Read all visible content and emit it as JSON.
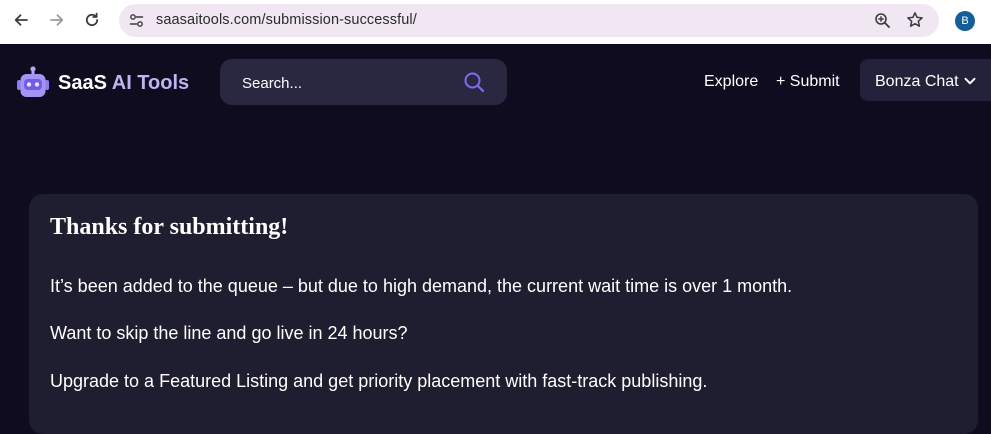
{
  "browser": {
    "url": "saasaitools.com/submission-successful/",
    "profile_initial": "B"
  },
  "header": {
    "logo_text_main": "SaaS",
    "logo_text_accent": " AI Tools",
    "search_placeholder": "Search...",
    "nav": {
      "explore_label": "Explore",
      "submit_label": "+ Submit"
    },
    "chat_dropdown_label": "Bonza Chat"
  },
  "card": {
    "title": "Thanks for submitting!",
    "paragraphs": [
      "It’s been added to the queue – but due to high demand, the current wait time is over 1 month.",
      "Want to skip the line and go live in 24 hours?",
      "Upgrade to a Featured Listing and get priority placement with fast-track publishing."
    ]
  },
  "colors": {
    "page_background": "#0e0c1e",
    "search_background": "#2a2840",
    "card_background": "#1f1d30",
    "accent_purple": "#7b6cf6",
    "logo_accent": "#bfb4f0",
    "omnibox_background": "#f0e7f3",
    "profile_avatar": "#155e97"
  }
}
